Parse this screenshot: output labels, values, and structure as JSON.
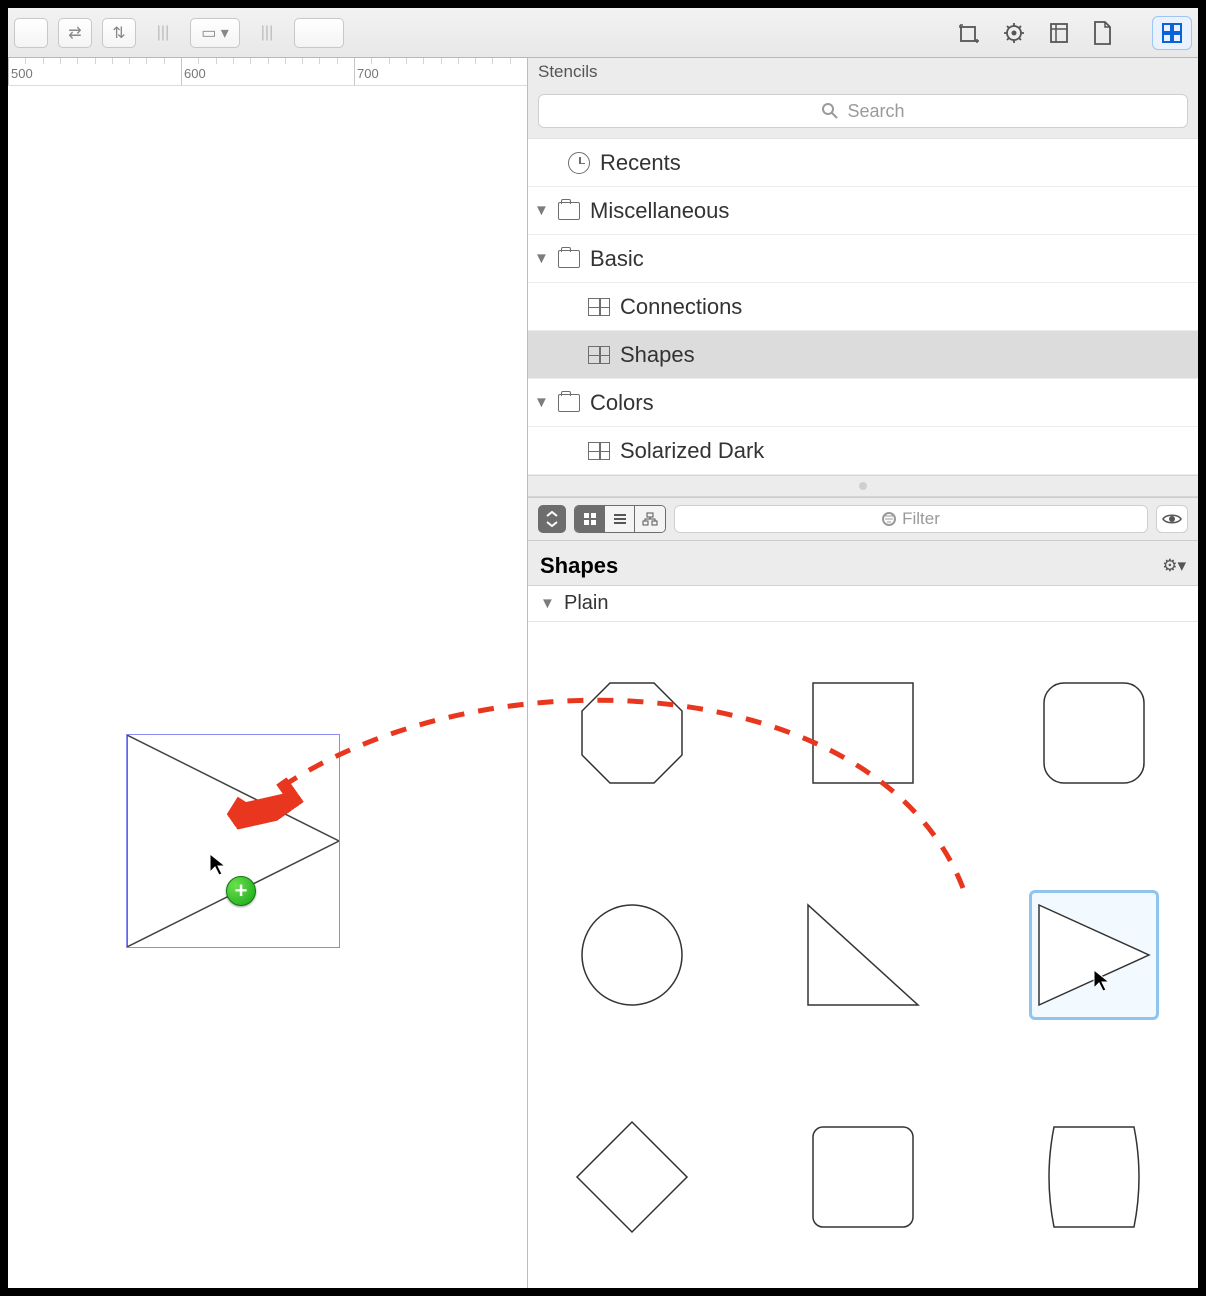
{
  "toolbar": {
    "swap_label": "⇄",
    "sort_label": "⇅",
    "columns_label": "|||",
    "fill_label": "▢",
    "spacer2": "|||"
  },
  "inspector_tabs": [
    "Object",
    "Properties",
    "Canvas",
    "Document",
    "Stencils"
  ],
  "panel_title": "Stencils",
  "search": {
    "placeholder": "Search"
  },
  "tree": {
    "recents": "Recents",
    "misc": "Miscellaneous",
    "basic": "Basic",
    "connections": "Connections",
    "shapes": "Shapes",
    "colors": "Colors",
    "solarized": "Solarized Dark"
  },
  "filter": {
    "placeholder": "Filter"
  },
  "shapes_header": "Shapes",
  "group_label": "Plain",
  "ruler": {
    "marks": [
      500,
      600,
      700
    ]
  },
  "shapes_grid": [
    "octagon",
    "square",
    "rounded-square",
    "circle",
    "right-triangle",
    "triangle-right",
    "diamond",
    "rounded-rect",
    "barrel"
  ],
  "selected_shape_index": 5
}
